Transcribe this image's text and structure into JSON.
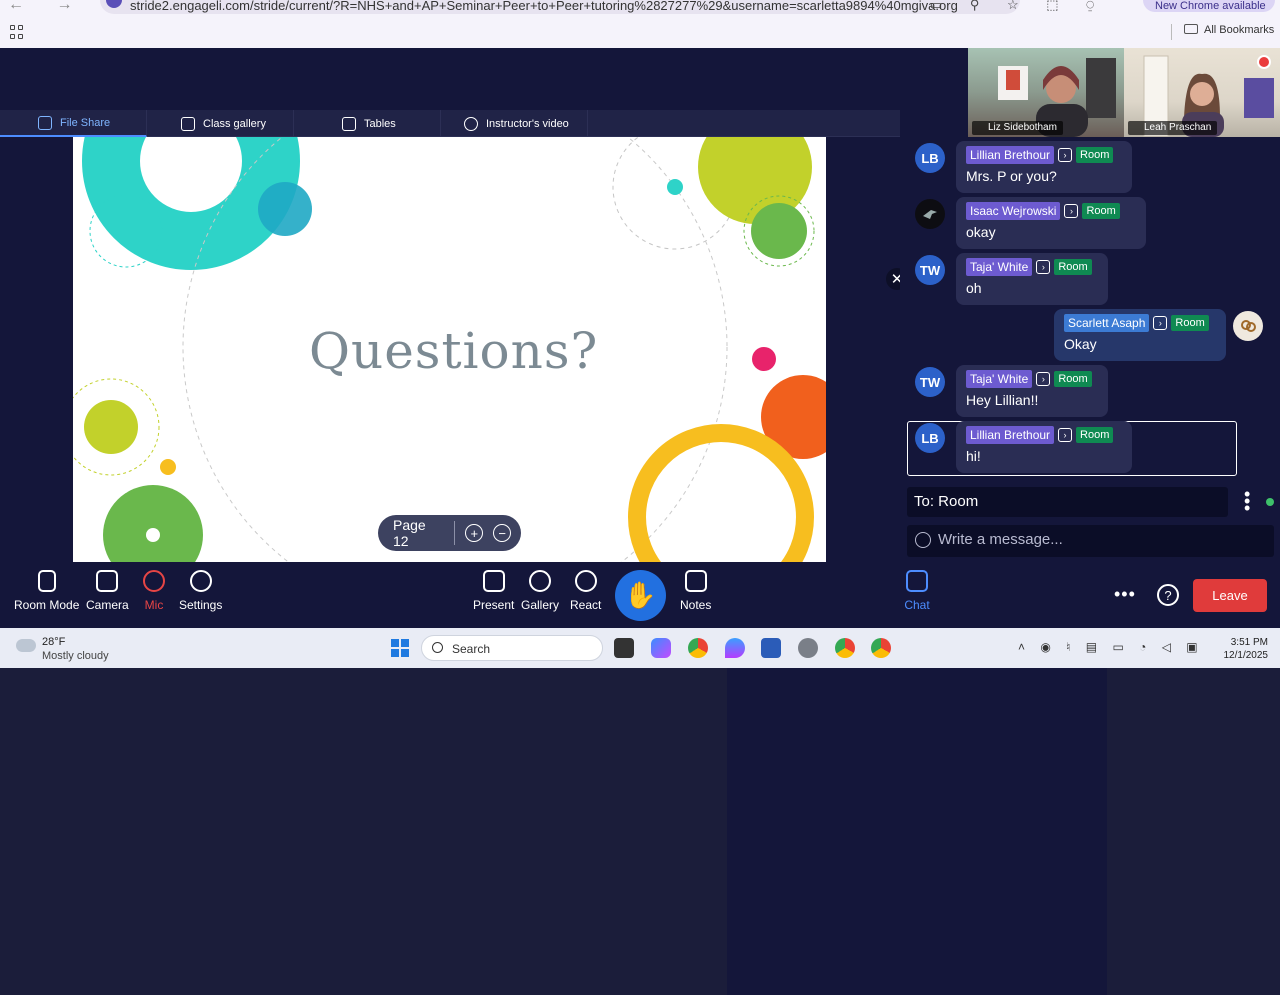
{
  "browser": {
    "url": "stride2.engageli.com/stride/current/?R=NHS+and+AP+Seminar+Peer+to+Peer+tutoring%2827277%29&username=scarletta9894%40mgiva.org",
    "update_label": "New Chrome available",
    "all_bookmarks": "All Bookmarks"
  },
  "tabs": [
    {
      "label": "File Share",
      "icon": "file-share-icon"
    },
    {
      "label": "Class gallery",
      "icon": "grid-icon"
    },
    {
      "label": "Tables",
      "icon": "tables-icon"
    },
    {
      "label": "Instructor's video",
      "icon": "video-icon"
    }
  ],
  "slide": {
    "title": "Questions?",
    "page_label": "Page 12"
  },
  "videos": [
    {
      "name": "Liz Sidebotham"
    },
    {
      "name": "Leah Praschan"
    }
  ],
  "chat": {
    "messages": [
      {
        "initials": "LB",
        "name": "Lillian Brethour",
        "room": "Room",
        "text": "Mrs. P or you?"
      },
      {
        "initials": "",
        "name": "Isaac Wejrowski",
        "room": "Room",
        "text": "okay"
      },
      {
        "initials": "TW",
        "name": "Taja' White",
        "room": "Room",
        "text": "oh"
      },
      {
        "initials": "",
        "name": "Scarlett Asaph",
        "room": "Room",
        "text": "Okay"
      },
      {
        "initials": "TW",
        "name": "Taja' White",
        "room": "Room",
        "text": "Hey Lillian!!"
      },
      {
        "initials": "LB",
        "name": "Lillian Brethour",
        "room": "Room",
        "text": "hi!"
      }
    ],
    "to_label": "To: Room",
    "write_placeholder": "Write a message..."
  },
  "toolbar": {
    "room_mode": "Room Mode",
    "camera": "Camera",
    "mic": "Mic",
    "settings": "Settings",
    "present": "Present",
    "gallery": "Gallery",
    "react": "React",
    "notes": "Notes",
    "chat": "Chat",
    "leave": "Leave"
  },
  "taskbar": {
    "temp": "28°F",
    "weather": "Mostly cloudy",
    "search": "Search",
    "time": "3:51 PM",
    "date": "12/1/2025"
  },
  "colors": {
    "accent": "#4d8dff",
    "leave": "#e03b3b",
    "room_badge": "#0f8a52",
    "name_badge": "#6d5bd0"
  }
}
